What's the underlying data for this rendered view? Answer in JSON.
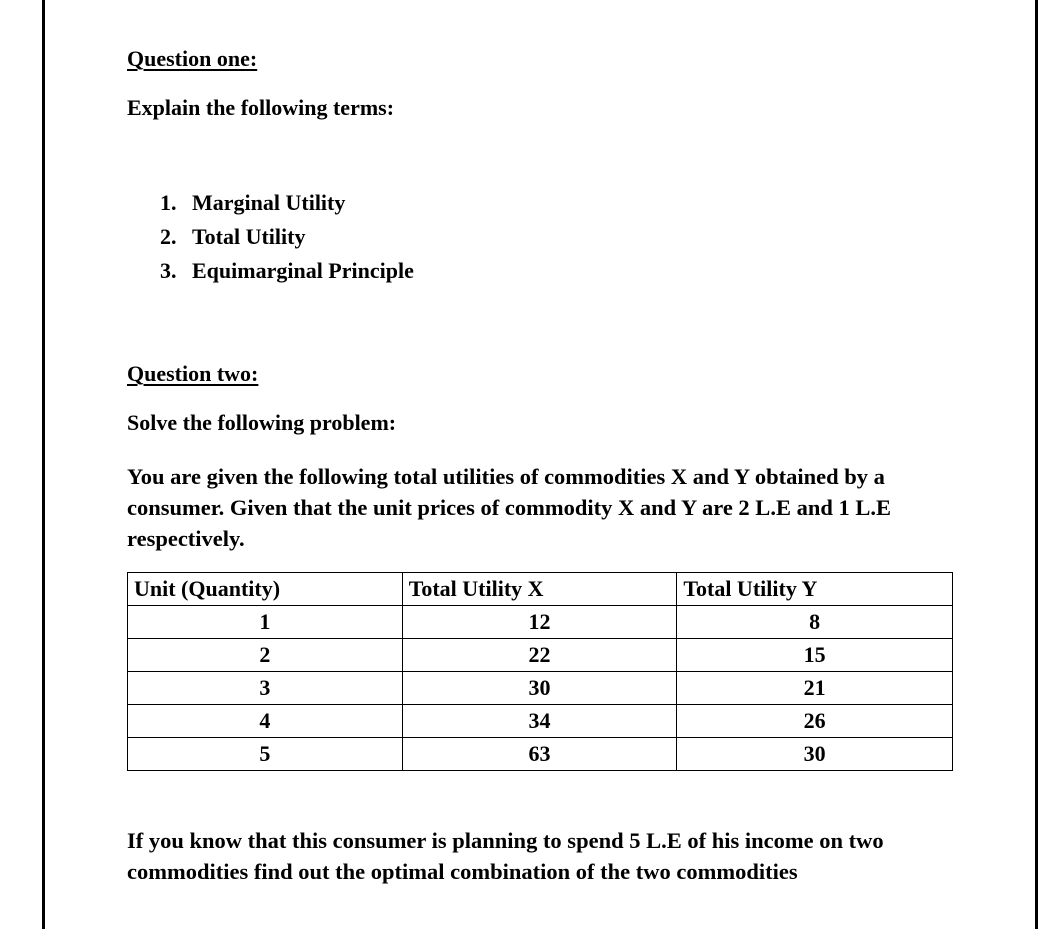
{
  "question_one": {
    "heading": "Question one:",
    "instruction": "Explain the following terms:",
    "terms": [
      {
        "number": "1.",
        "label": "Marginal Utility"
      },
      {
        "number": "2.",
        "label": "Total Utility"
      },
      {
        "number": "3.",
        "label": "Equimarginal Principle"
      }
    ]
  },
  "question_two": {
    "heading": "Question two:",
    "instruction": "Solve the following problem:",
    "intro": "You are given the following total utilities of commodities X and Y obtained by a consumer. Given that the unit prices of commodity X and Y are 2 L.E and 1 L.E respectively.",
    "table": {
      "headers": [
        "Unit (Quantity)",
        "Total Utility X",
        "Total Utility Y"
      ],
      "rows": [
        [
          "1",
          "12",
          "8"
        ],
        [
          "2",
          "22",
          "15"
        ],
        [
          "3",
          "30",
          "21"
        ],
        [
          "4",
          "34",
          "26"
        ],
        [
          "5",
          "63",
          "30"
        ]
      ]
    },
    "task": "If you know that this consumer is planning to spend 5 L.E of his income on two commodities find out the optimal combination of the two commodities"
  }
}
